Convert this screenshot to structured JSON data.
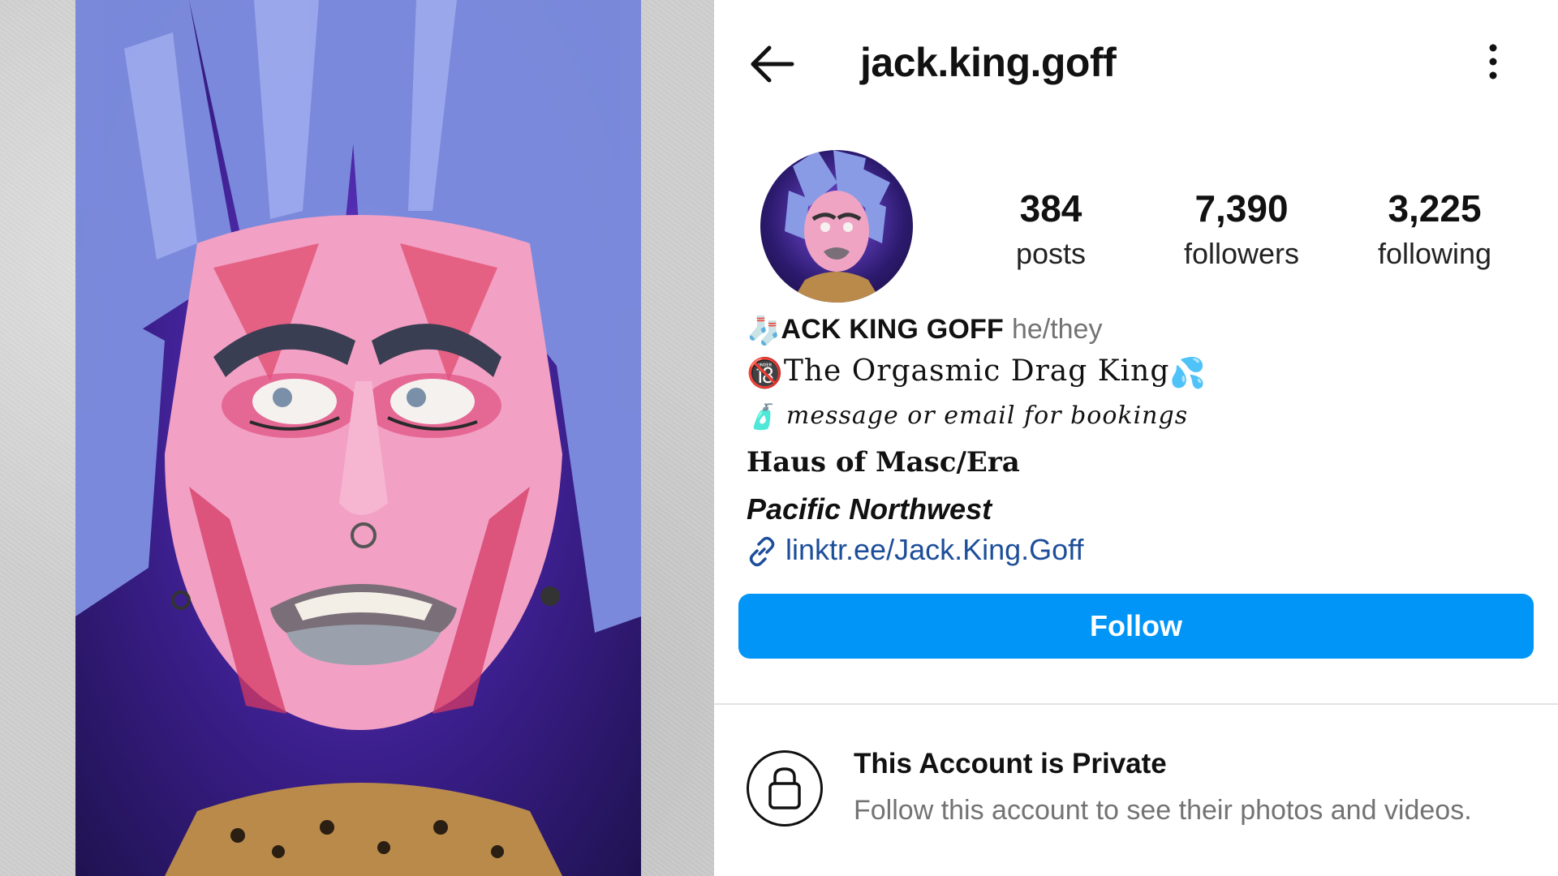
{
  "header": {
    "username": "jack.king.goff"
  },
  "stats": {
    "posts": {
      "value": "384",
      "label": "posts"
    },
    "followers": {
      "value": "7,390",
      "label": "followers"
    },
    "following": {
      "value": "3,225",
      "label": "following"
    }
  },
  "bio": {
    "name_emoji": "🧦",
    "name": "ACK KING GOFF",
    "pronouns": "he/they",
    "tagline_emoji_start": "🔞",
    "tagline": "The Orgasmic Drag King",
    "tagline_emoji_end": "💦",
    "message_emoji": "🧴",
    "message": "message or email for bookings",
    "haus": "Haus of Masc/Era",
    "location": "Pacific Northwest",
    "link": "linktr.ee/Jack.King.Goff"
  },
  "actions": {
    "follow_label": "Follow"
  },
  "private": {
    "title": "This Account is Private",
    "subtitle": "Follow this account to see their photos and videos."
  },
  "colors": {
    "follow_blue": "#0095f6",
    "link_blue": "#1d4e9a",
    "muted_text": "#737373"
  },
  "icons": [
    "back-arrow-icon",
    "more-vertical-icon",
    "link-icon",
    "lock-icon"
  ]
}
